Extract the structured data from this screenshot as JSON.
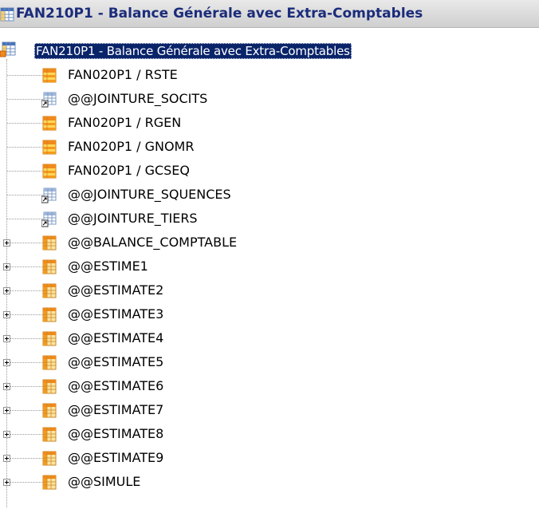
{
  "window": {
    "title": "FAN210P1 - Balance Générale avec Extra-Comptables",
    "title_icon": "grid-table-icon"
  },
  "tree": {
    "root": {
      "label": "FAN210P1 - Balance Générale avec Extra-Comptables",
      "icon": "grid-table-icon",
      "selected": true
    },
    "items": [
      {
        "label": "FAN020P1 / RSTE",
        "icon": "orange-table-icon",
        "expandable": false
      },
      {
        "label": "@@JOINTURE_SOCITS",
        "icon": "join-shortcut-icon",
        "expandable": false
      },
      {
        "label": "FAN020P1 / RGEN",
        "icon": "orange-table-icon",
        "expandable": false
      },
      {
        "label": "FAN020P1 / GNOMR",
        "icon": "orange-table-icon",
        "expandable": false
      },
      {
        "label": "FAN020P1 / GCSEQ",
        "icon": "orange-table-icon",
        "expandable": false
      },
      {
        "label": "@@JOINTURE_SQUENCES",
        "icon": "join-shortcut-icon",
        "expandable": false
      },
      {
        "label": "@@JOINTURE_TIERS",
        "icon": "join-shortcut-icon",
        "expandable": false
      },
      {
        "label": "@@BALANCE_COMPTABLE",
        "icon": "grid-orange-icon",
        "expandable": true
      },
      {
        "label": "@@ESTIME1",
        "icon": "grid-orange-icon",
        "expandable": true
      },
      {
        "label": "@@ESTIMATE2",
        "icon": "grid-orange-icon",
        "expandable": true
      },
      {
        "label": "@@ESTIMATE3",
        "icon": "grid-orange-icon",
        "expandable": true
      },
      {
        "label": "@@ESTIMATE4",
        "icon": "grid-orange-icon",
        "expandable": true
      },
      {
        "label": "@@ESTIMATE5",
        "icon": "grid-orange-icon",
        "expandable": true
      },
      {
        "label": "@@ESTIMATE6",
        "icon": "grid-orange-icon",
        "expandable": true
      },
      {
        "label": "@@ESTIMATE7",
        "icon": "grid-orange-icon",
        "expandable": true
      },
      {
        "label": "@@ESTIMATE8",
        "icon": "grid-orange-icon",
        "expandable": true
      },
      {
        "label": "@@ESTIMATE9",
        "icon": "grid-orange-icon",
        "expandable": true
      },
      {
        "label": "@@SIMULE",
        "icon": "grid-orange-icon",
        "expandable": true
      }
    ]
  },
  "colors": {
    "title_text": "#1b2c7a",
    "selection_bg": "#0a246a",
    "selection_text": "#ffffff",
    "icon_orange": "#f59a1c",
    "icon_yellow": "#fcd75a",
    "grid_blue": "#7d9cc6"
  }
}
